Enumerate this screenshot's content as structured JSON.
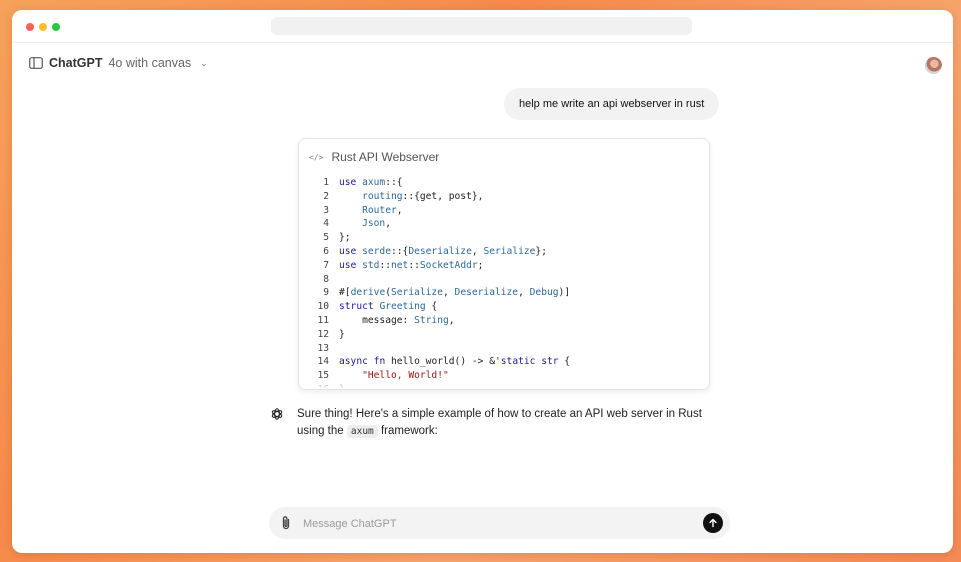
{
  "header": {
    "model_name": "ChatGPT",
    "model_suffix": "4o with canvas"
  },
  "conversation": {
    "user_message": "help me write an api webserver in rust",
    "assistant_text_before": "Sure thing! Here's a simple example of how to create an API web server in Rust using the ",
    "assistant_inline_code": "axum",
    "assistant_text_after": " framework:"
  },
  "canvas": {
    "title": "Rust API Webserver",
    "code_lines": [
      "use axum::{",
      "    routing::{get, post},",
      "    Router,",
      "    Json,",
      "};",
      "use serde::{Deserialize, Serialize};",
      "use std::net::SocketAddr;",
      "",
      "#[derive(Serialize, Deserialize, Debug)]",
      "struct Greeting {",
      "    message: String,",
      "}",
      "",
      "async fn hello_world() -> &'static str {",
      "    \"Hello, World!\"",
      "}"
    ]
  },
  "composer": {
    "placeholder": "Message ChatGPT"
  },
  "icons": {
    "sidebar": "sidebar-toggle-icon",
    "chevron": "chevron-down-icon",
    "code": "code-icon",
    "assistant": "openai-logo-icon",
    "attach": "paperclip-icon",
    "send": "arrow-up-icon"
  },
  "colors": {
    "background_gradient": "#f68a4a",
    "keyword": "#1a1aa6",
    "type": "#2a6aa0",
    "string": "#a11111",
    "send_button": "#111111"
  }
}
